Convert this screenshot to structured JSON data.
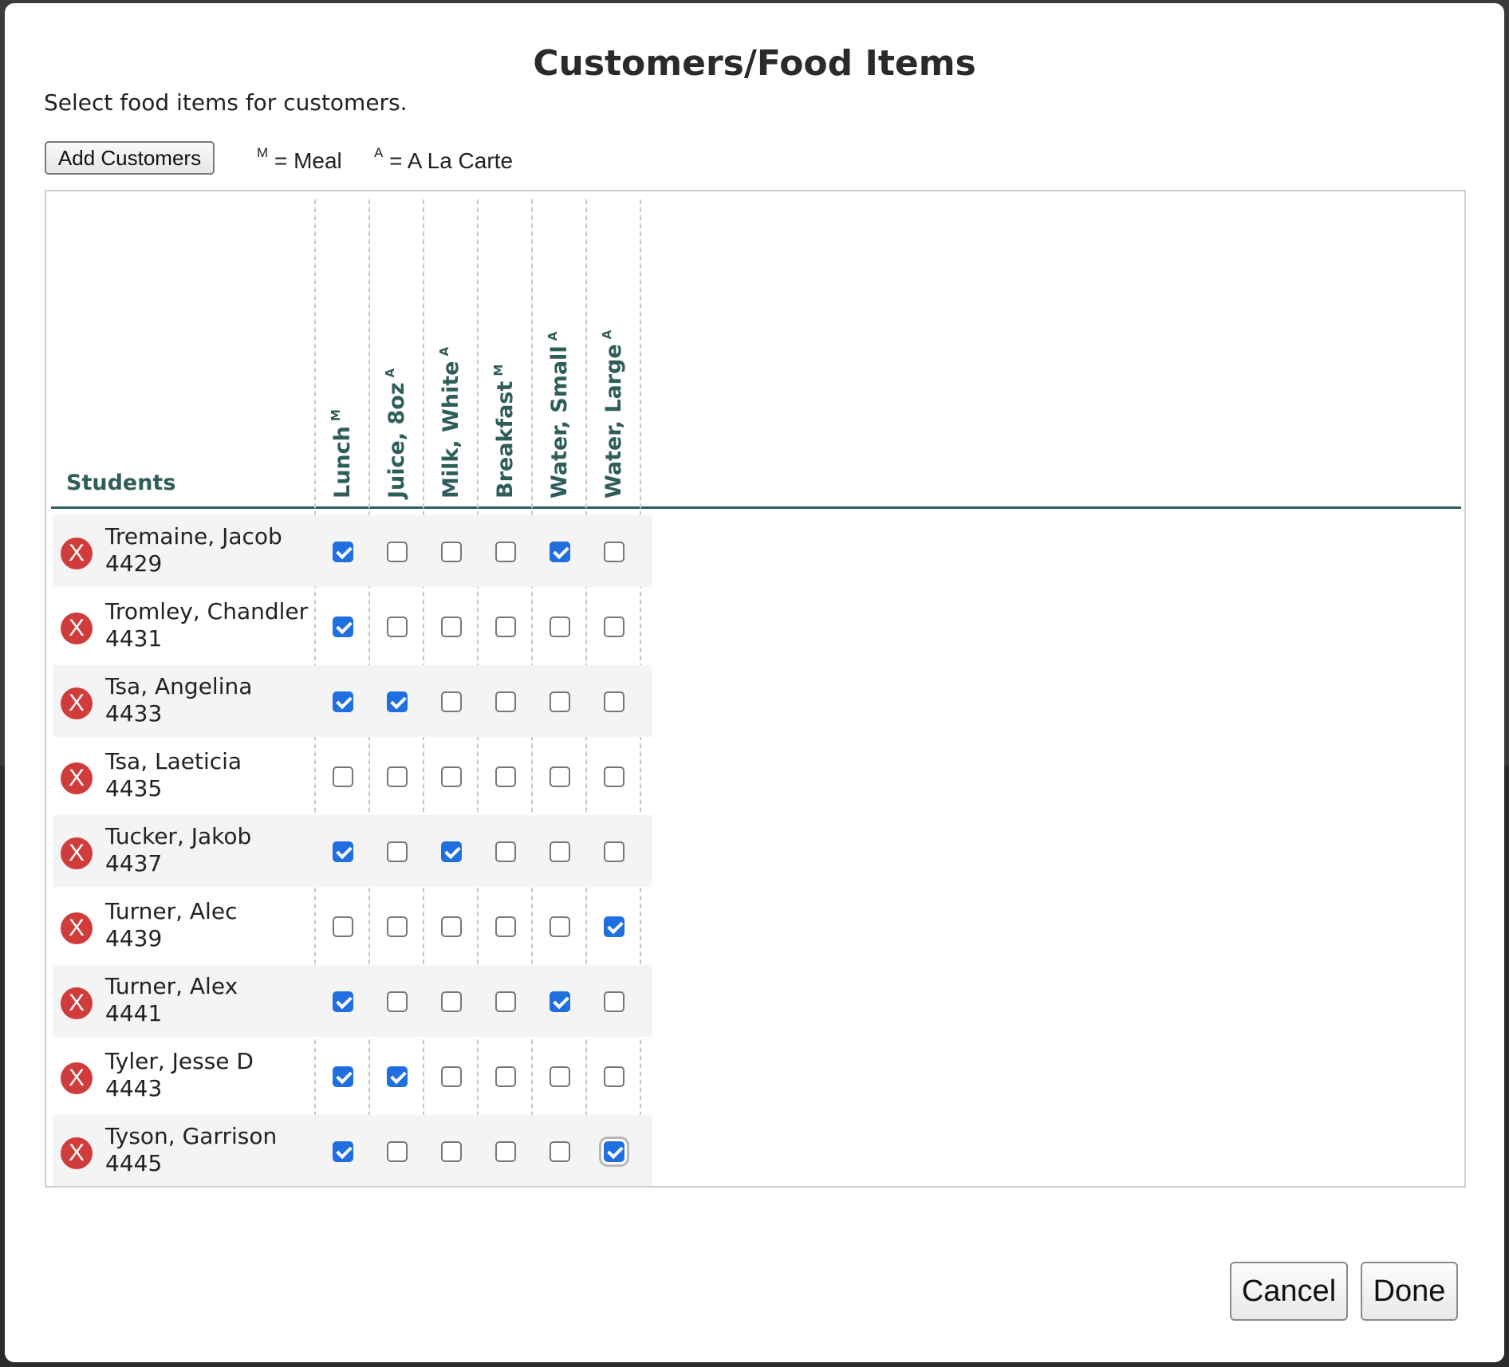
{
  "dialog": {
    "title": "Customers/Food Items",
    "subtitle": "Select food items for customers.",
    "add_customers_label": "Add Customers",
    "legend": {
      "meal_marker": "M",
      "meal_text": "= Meal",
      "a_la_carte_marker": "A",
      "a_la_carte_text": "= A La Carte"
    },
    "cancel_label": "Cancel",
    "done_label": "Done"
  },
  "grid": {
    "students_header": "Students",
    "columns": [
      {
        "label": "Lunch",
        "marker": "M"
      },
      {
        "label": "Juice, 8oz",
        "marker": "A"
      },
      {
        "label": "Milk, White",
        "marker": "A"
      },
      {
        "label": "Breakfast",
        "marker": "M"
      },
      {
        "label": "Water, Small",
        "marker": "A"
      },
      {
        "label": "Water, Large",
        "marker": "A"
      }
    ],
    "rows": [
      {
        "name": "Tremaine, Jacob",
        "id": "4429",
        "checks": [
          true,
          false,
          false,
          false,
          true,
          false
        ]
      },
      {
        "name": "Tromley, Chandler",
        "id": "4431",
        "checks": [
          true,
          false,
          false,
          false,
          false,
          false
        ]
      },
      {
        "name": "Tsa, Angelina",
        "id": "4433",
        "checks": [
          true,
          true,
          false,
          false,
          false,
          false
        ]
      },
      {
        "name": "Tsa, Laeticia",
        "id": "4435",
        "checks": [
          false,
          false,
          false,
          false,
          false,
          false
        ]
      },
      {
        "name": "Tucker, Jakob",
        "id": "4437",
        "checks": [
          true,
          false,
          true,
          false,
          false,
          false
        ]
      },
      {
        "name": "Turner, Alec",
        "id": "4439",
        "checks": [
          false,
          false,
          false,
          false,
          false,
          true
        ]
      },
      {
        "name": "Turner, Alex",
        "id": "4441",
        "checks": [
          true,
          false,
          false,
          false,
          true,
          false
        ]
      },
      {
        "name": "Tyler, Jesse D",
        "id": "4443",
        "checks": [
          true,
          true,
          false,
          false,
          false,
          false
        ]
      },
      {
        "name": "Tyson, Garrison",
        "id": "4445",
        "checks": [
          true,
          false,
          false,
          false,
          false,
          true
        ]
      }
    ],
    "remove_icon_glyph": "X"
  }
}
